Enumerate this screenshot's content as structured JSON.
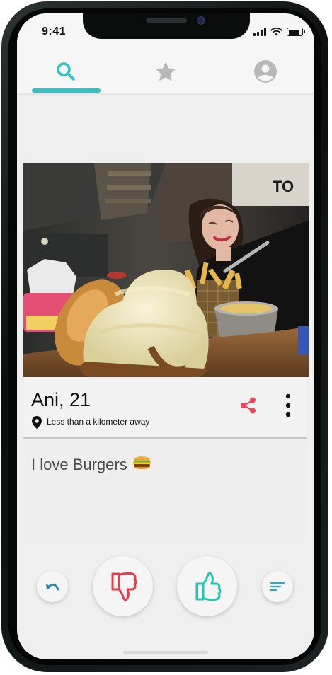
{
  "status_bar": {
    "time": "9:41"
  },
  "tabs": [
    {
      "icon": "search-icon",
      "active": true
    },
    {
      "icon": "star-icon",
      "active": false
    },
    {
      "icon": "profile-icon",
      "active": false
    }
  ],
  "profile": {
    "name_age": "Ani, 21",
    "distance": "Less than a kilometer away",
    "bio": "I love Burgers",
    "bio_emoji": "burger-emoji"
  },
  "actions": [
    {
      "icon": "undo-icon"
    },
    {
      "icon": "thumbs-down-icon"
    },
    {
      "icon": "thumbs-up-icon"
    },
    {
      "icon": "filter-icon"
    }
  ],
  "colors": {
    "accent": "#2fc3c8",
    "dislike": "#e8394d",
    "like": "#1fc6b0",
    "share": "#f0455b",
    "inactive_tab": "#b8b8b8"
  }
}
